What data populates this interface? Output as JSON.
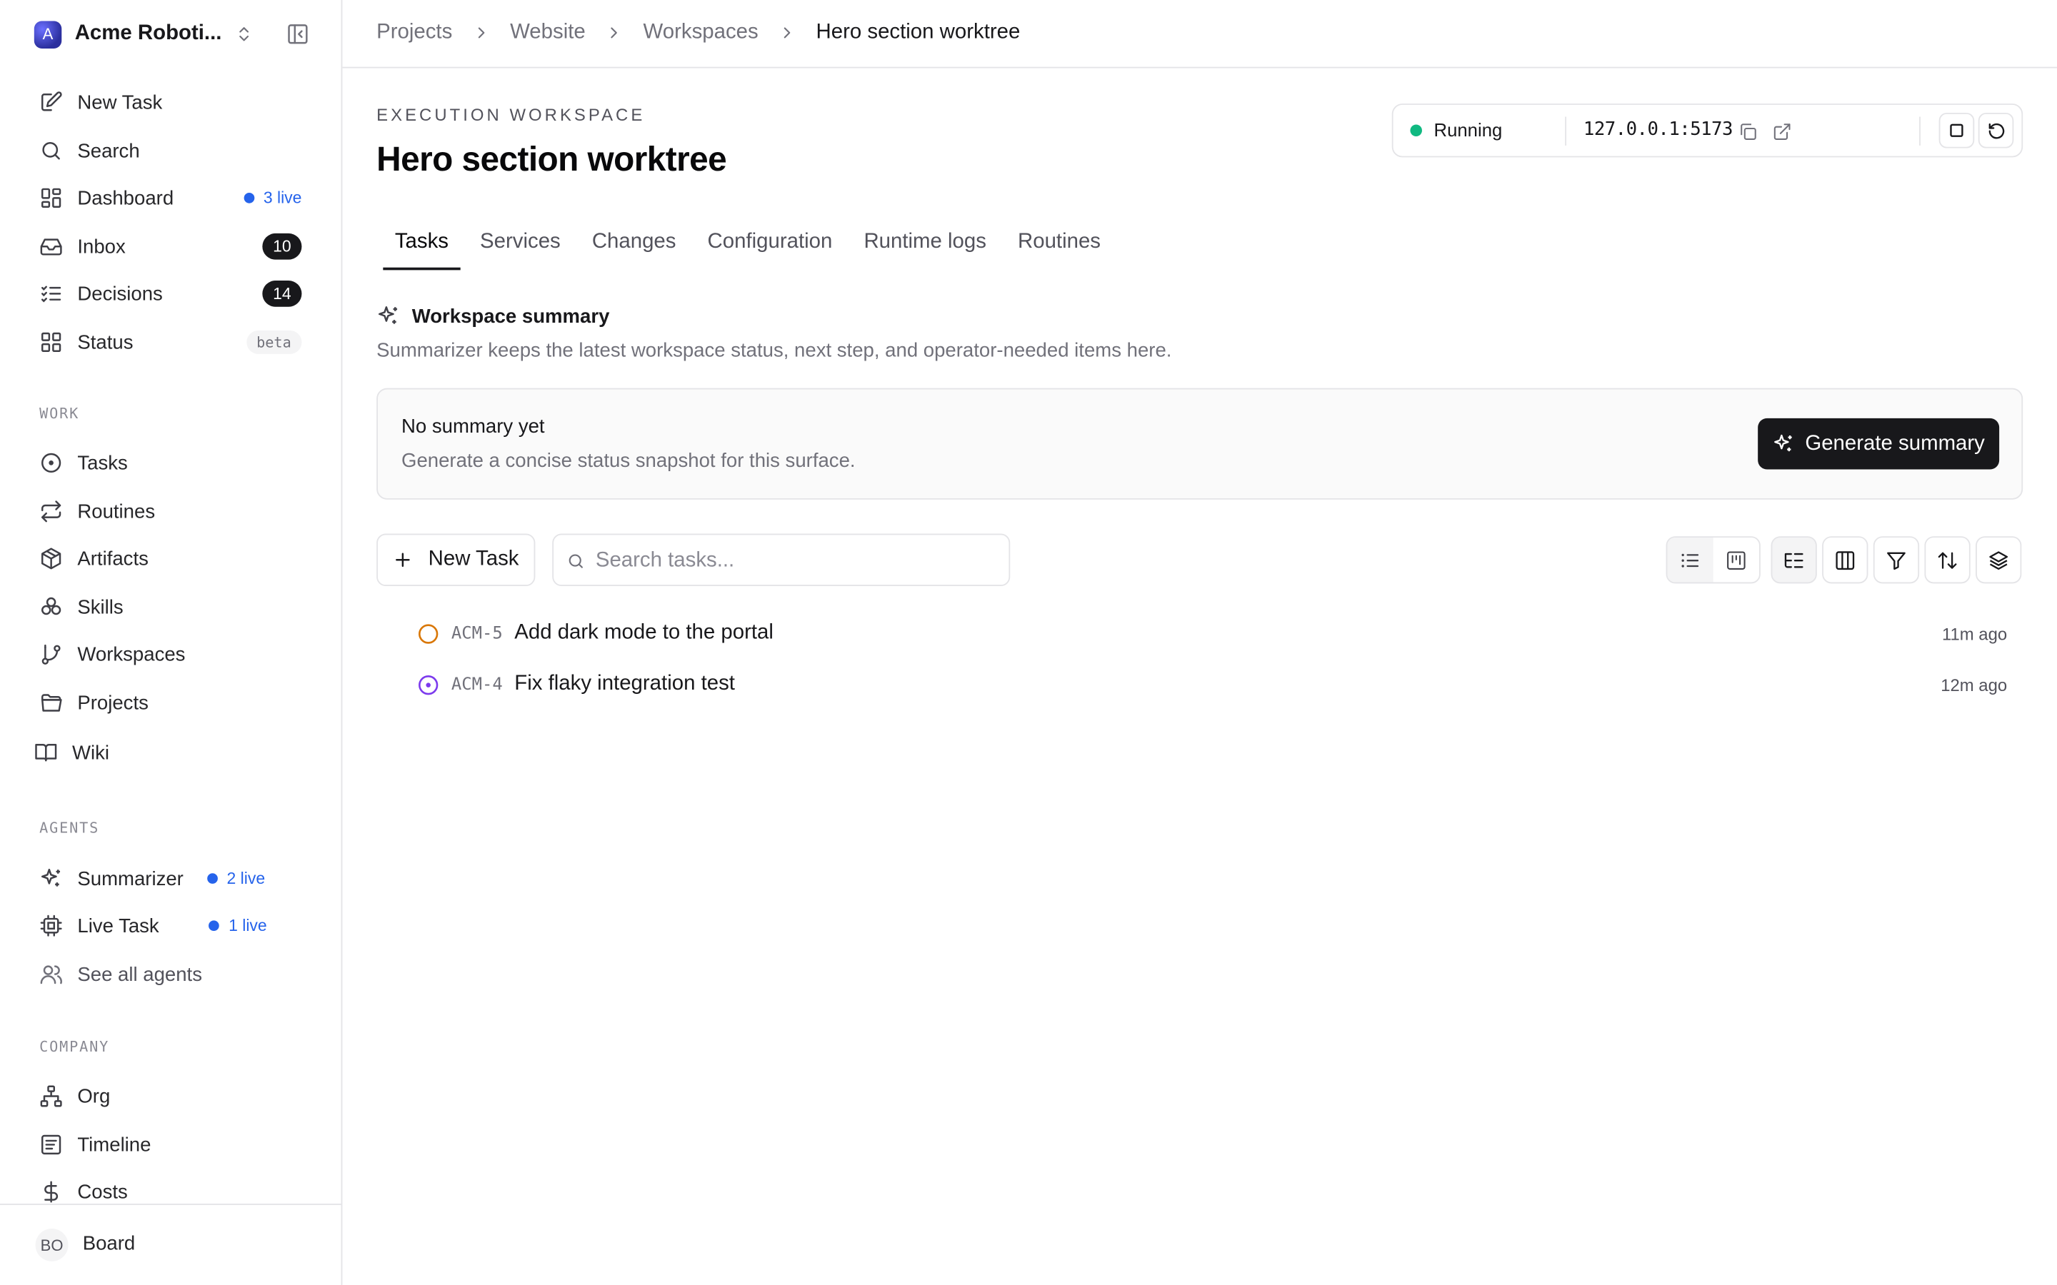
{
  "org": {
    "initial": "A",
    "name": "Acme Roboti..."
  },
  "nav_top": [
    {
      "label": "New Task",
      "icon": "edit-icon"
    },
    {
      "label": "Search",
      "icon": "search-icon"
    },
    {
      "label": "Dashboard",
      "icon": "dashboard-icon",
      "live": "3 live"
    },
    {
      "label": "Inbox",
      "icon": "inbox-icon",
      "count": "10"
    },
    {
      "label": "Decisions",
      "icon": "checklist-icon",
      "count": "14"
    },
    {
      "label": "Status",
      "icon": "grid-icon",
      "badge": "beta"
    }
  ],
  "sections": {
    "work": "WORK",
    "agents": "AGENTS",
    "company": "COMPANY"
  },
  "nav_work": [
    {
      "label": "Tasks",
      "icon": "circle-dot-icon"
    },
    {
      "label": "Routines",
      "icon": "repeat-icon"
    },
    {
      "label": "Artifacts",
      "icon": "package-icon"
    },
    {
      "label": "Skills",
      "icon": "skills-icon"
    },
    {
      "label": "Workspaces",
      "icon": "branch-icon"
    },
    {
      "label": "Projects",
      "icon": "folder-icon"
    },
    {
      "label": "Wiki",
      "icon": "book-icon"
    }
  ],
  "nav_agents": [
    {
      "label": "Summarizer",
      "icon": "sparkles-icon",
      "live": "2 live"
    },
    {
      "label": "Live Task",
      "icon": "cpu-icon",
      "live": "1 live"
    },
    {
      "label": "See all agents",
      "icon": "users-icon"
    }
  ],
  "nav_company": [
    {
      "label": "Org",
      "icon": "org-chart-icon"
    },
    {
      "label": "Timeline",
      "icon": "timeline-icon"
    },
    {
      "label": "Costs",
      "icon": "dollar-icon"
    }
  ],
  "footer": {
    "initials": "BO",
    "name": "Board"
  },
  "breadcrumbs": [
    "Projects",
    "Website",
    "Workspaces",
    "Hero section worktree"
  ],
  "eyebrow": "EXECUTION WORKSPACE",
  "title": "Hero section worktree",
  "runtime": {
    "status": "Running",
    "url": "127.0.0.1:5173",
    "status_color": "#10b981"
  },
  "tabs": [
    "Tasks",
    "Services",
    "Changes",
    "Configuration",
    "Runtime logs",
    "Routines"
  ],
  "summary": {
    "heading": "Workspace summary",
    "description": "Summarizer keeps the latest workspace status, next step, and operator-needed items here.",
    "empty_title": "No summary yet",
    "empty_desc": "Generate a concise status snapshot for this surface.",
    "button": "Generate summary"
  },
  "toolbar": {
    "new_task": "New Task",
    "search_placeholder": "Search tasks..."
  },
  "tasks": [
    {
      "key": "ACM-5",
      "title": "Add dark mode to the portal",
      "ago": "11m ago",
      "status": "todo",
      "status_color": "#d97706"
    },
    {
      "key": "ACM-4",
      "title": "Fix flaky integration test",
      "ago": "12m ago",
      "status": "in-progress",
      "status_color": "#7c3aed"
    }
  ]
}
